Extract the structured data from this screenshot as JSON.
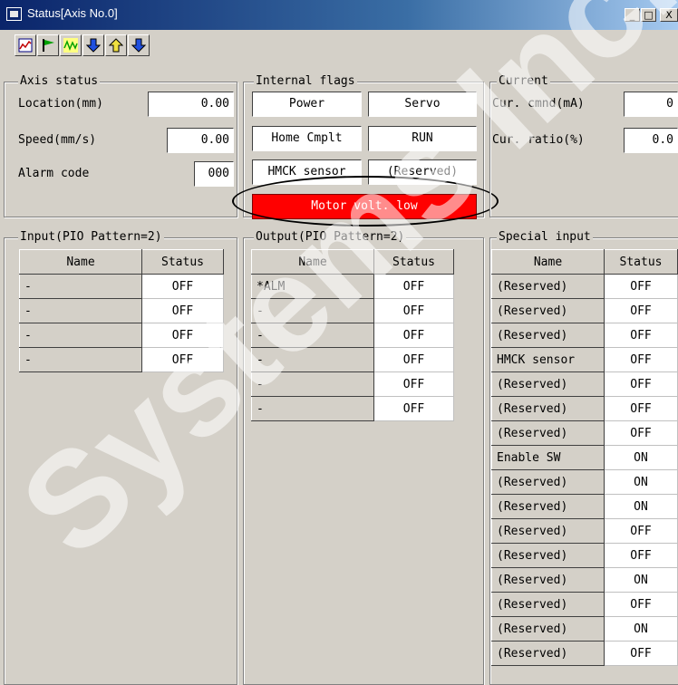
{
  "window": {
    "title": "Status[Axis No.0]",
    "minimize": "_",
    "maximize": "□",
    "close": "X"
  },
  "toolbar": {
    "buttons": [
      {
        "name": "chart-icon"
      },
      {
        "name": "flag-icon"
      },
      {
        "name": "wave-icon"
      },
      {
        "name": "arrow-down-blue-icon"
      },
      {
        "name": "arrow-up-yellow-icon"
      },
      {
        "name": "arrow-down-blue-icon"
      }
    ]
  },
  "axis_status": {
    "title": "Axis status",
    "location_label": "Location(mm)",
    "location_value": "0.00",
    "speed_label": "Speed(mm/s)",
    "speed_value": "0.00",
    "alarm_label": "Alarm code",
    "alarm_value": "000"
  },
  "internal_flags": {
    "title": "Internal flags",
    "flags": [
      "Power",
      "Servo",
      "Home Cmplt",
      "RUN",
      "HMCK sensor",
      "(Reserved)"
    ],
    "alert": "Motor volt. low",
    "alert_color": "#ff0000"
  },
  "current": {
    "title": "Current",
    "cmnd_label": "Cur. cmnd(mA)",
    "cmnd_value": "0",
    "ratio_label": "Cur. ratio(%)",
    "ratio_value": "0.0"
  },
  "input": {
    "title": "Input(PIO Pattern=2)",
    "headers": [
      "Name",
      "Status"
    ],
    "rows": [
      [
        "-",
        "OFF"
      ],
      [
        "-",
        "OFF"
      ],
      [
        "-",
        "OFF"
      ],
      [
        "-",
        "OFF"
      ]
    ]
  },
  "output": {
    "title": "Output(PIO Pattern=2)",
    "headers": [
      "Name",
      "Status"
    ],
    "rows": [
      [
        "*ALM",
        "OFF"
      ],
      [
        "-",
        "OFF"
      ],
      [
        "-",
        "OFF"
      ],
      [
        "-",
        "OFF"
      ],
      [
        "-",
        "OFF"
      ],
      [
        "-",
        "OFF"
      ]
    ]
  },
  "special_input": {
    "title": "Special input",
    "headers": [
      "Name",
      "Status"
    ],
    "rows": [
      [
        "(Reserved)",
        "OFF"
      ],
      [
        "(Reserved)",
        "OFF"
      ],
      [
        "(Reserved)",
        "OFF"
      ],
      [
        "HMCK sensor",
        "OFF"
      ],
      [
        "(Reserved)",
        "OFF"
      ],
      [
        "(Reserved)",
        "OFF"
      ],
      [
        "(Reserved)",
        "OFF"
      ],
      [
        "Enable SW",
        "ON"
      ],
      [
        "(Reserved)",
        "ON"
      ],
      [
        "(Reserved)",
        "ON"
      ],
      [
        "(Reserved)",
        "OFF"
      ],
      [
        "(Reserved)",
        "OFF"
      ],
      [
        "(Reserved)",
        "ON"
      ],
      [
        "(Reserved)",
        "OFF"
      ],
      [
        "(Reserved)",
        "ON"
      ],
      [
        "(Reserved)",
        "OFF"
      ]
    ]
  },
  "watermark": "Systems Inc."
}
